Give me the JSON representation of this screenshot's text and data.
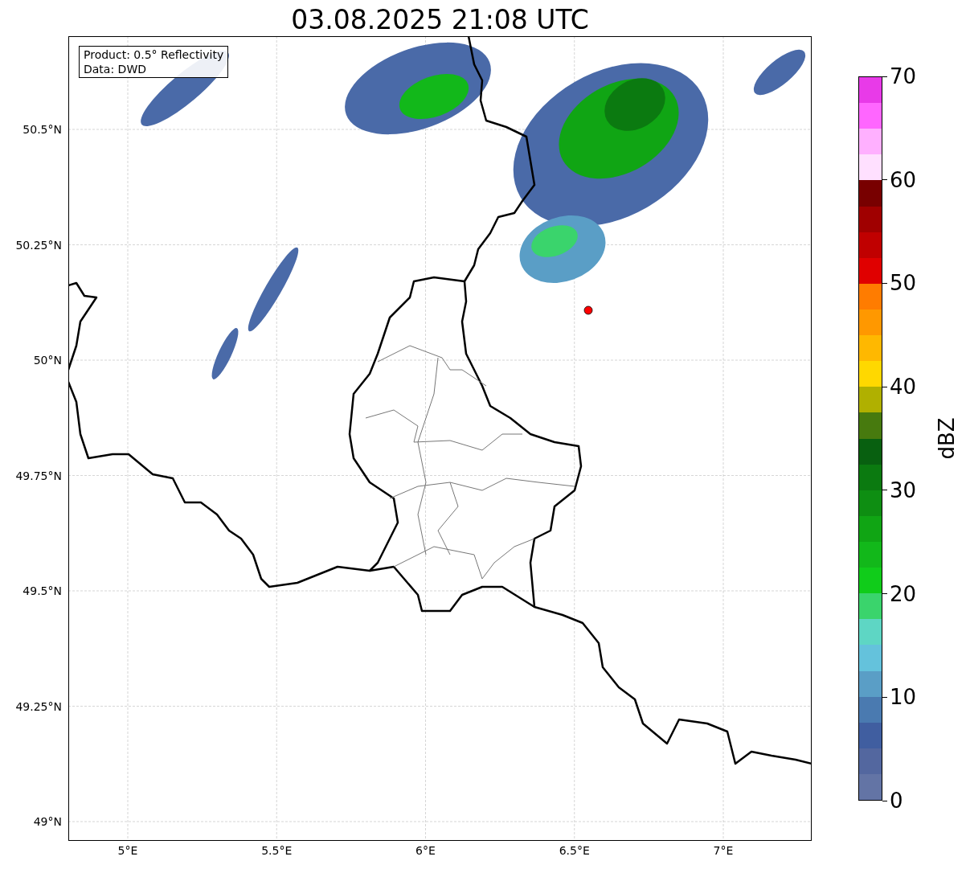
{
  "title": "03.08.2025 21:08 UTC",
  "info_box": [
    "Product: 0.5° Reflectivity",
    "Data: DWD"
  ],
  "lat_labels": [
    "50.5°N",
    "50.25°N",
    "50°N",
    "49.75°N",
    "49.5°N",
    "49.25°N",
    "49°N"
  ],
  "lon_labels": [
    "5°E",
    "5.5°E",
    "6°E",
    "6.5°E",
    "7°E"
  ],
  "colorbar": {
    "label": "dBZ",
    "ticks": [
      "70",
      "60",
      "50",
      "40",
      "30",
      "20",
      "10",
      "0"
    ],
    "bands": [
      {
        "color": "#e83ae8"
      },
      {
        "color": "#ff66ff"
      },
      {
        "color": "#ffb0ff"
      },
      {
        "color": "#ffe0ff"
      },
      {
        "color": "#780000"
      },
      {
        "color": "#a00000"
      },
      {
        "color": "#c00000"
      },
      {
        "color": "#e00000"
      },
      {
        "color": "#ff7c00"
      },
      {
        "color": "#ff9800"
      },
      {
        "color": "#ffb800"
      },
      {
        "color": "#ffd800"
      },
      {
        "color": "#b0b000"
      },
      {
        "color": "#477a0e"
      },
      {
        "color": "#086010"
      },
      {
        "color": "#0b7a10"
      },
      {
        "color": "#0e8e12"
      },
      {
        "color": "#10a514"
      },
      {
        "color": "#12b81a"
      },
      {
        "color": "#10cc1a"
      },
      {
        "color": "#3ad46c"
      },
      {
        "color": "#5ed6c4"
      },
      {
        "color": "#64c2dc"
      },
      {
        "color": "#5a9ec6"
      },
      {
        "color": "#4a7ab0"
      },
      {
        "color": "#405ea0"
      },
      {
        "color": "#53679f"
      },
      {
        "color": "#6374a5"
      }
    ]
  }
}
